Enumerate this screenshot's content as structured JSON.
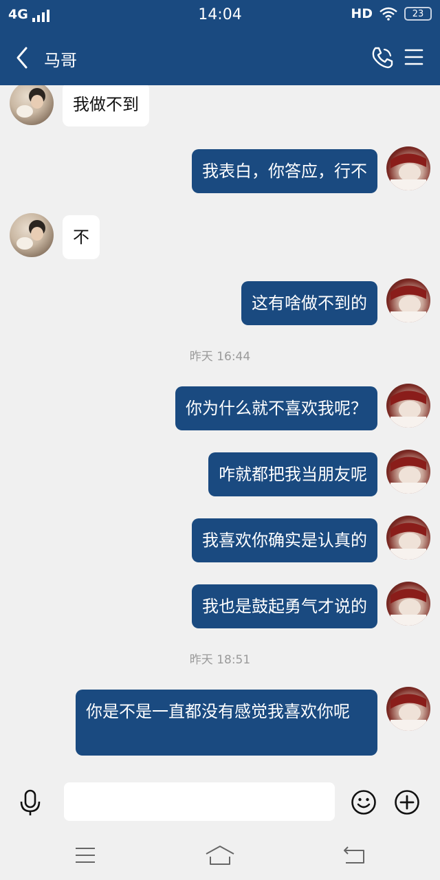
{
  "status_bar": {
    "network": "4G",
    "time": "14:04",
    "hd": "HD",
    "battery": "23"
  },
  "header": {
    "contact_name": "马哥"
  },
  "messages": [
    {
      "from": "them",
      "text": "我做不到"
    },
    {
      "from": "me",
      "text": "我表白，你答应，行不"
    },
    {
      "from": "them",
      "text": "不"
    },
    {
      "from": "me",
      "text": "这有啥做不到的"
    },
    {
      "type": "time",
      "text": "昨天 16:44"
    },
    {
      "from": "me",
      "text": "你为什么就不喜欢我呢？"
    },
    {
      "from": "me",
      "text": "咋就都把我当朋友呢"
    },
    {
      "from": "me",
      "text": "我喜欢你确实是认真的"
    },
    {
      "from": "me",
      "text": "我也是鼓起勇气才说的"
    },
    {
      "type": "time",
      "text": "昨天 18:51"
    },
    {
      "from": "me",
      "text": "你是不是一直都没有感觉我喜欢你呢"
    }
  ],
  "input": {
    "value": "",
    "placeholder": ""
  },
  "icons": {
    "back": "chevron-left-icon",
    "call": "phone-icon",
    "menu": "hamburger-menu-icon",
    "voice": "microphone-icon",
    "emoji": "smiley-icon",
    "more": "plus-circle-icon",
    "sys_menu": "menu-lines-icon",
    "sys_home": "home-icon",
    "sys_back": "return-icon"
  },
  "colors": {
    "header": "#1a4a80",
    "my_bubble": "#1a4a80",
    "their_bubble": "#ffffff",
    "background": "#f0f0f0"
  }
}
